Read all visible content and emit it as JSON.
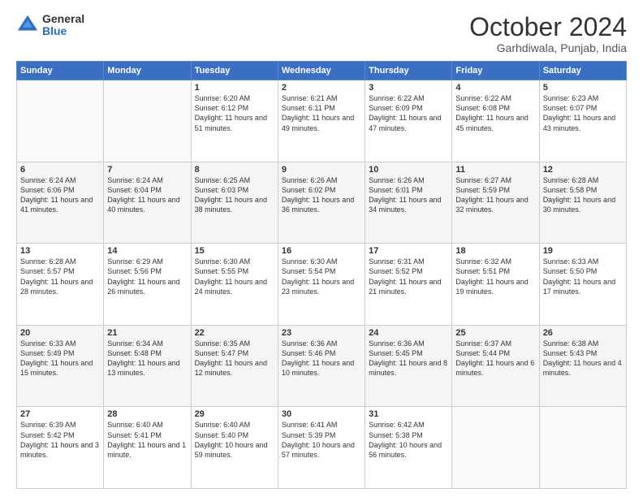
{
  "logo": {
    "general": "General",
    "blue": "Blue"
  },
  "title": "October 2024",
  "subtitle": "Garhdiwala, Punjab, India",
  "headers": [
    "Sunday",
    "Monday",
    "Tuesday",
    "Wednesday",
    "Thursday",
    "Friday",
    "Saturday"
  ],
  "weeks": [
    [
      {
        "day": "",
        "info": ""
      },
      {
        "day": "",
        "info": ""
      },
      {
        "day": "1",
        "info": "Sunrise: 6:20 AM\nSunset: 6:12 PM\nDaylight: 11 hours and 51 minutes."
      },
      {
        "day": "2",
        "info": "Sunrise: 6:21 AM\nSunset: 6:11 PM\nDaylight: 11 hours and 49 minutes."
      },
      {
        "day": "3",
        "info": "Sunrise: 6:22 AM\nSunset: 6:09 PM\nDaylight: 11 hours and 47 minutes."
      },
      {
        "day": "4",
        "info": "Sunrise: 6:22 AM\nSunset: 6:08 PM\nDaylight: 11 hours and 45 minutes."
      },
      {
        "day": "5",
        "info": "Sunrise: 6:23 AM\nSunset: 6:07 PM\nDaylight: 11 hours and 43 minutes."
      }
    ],
    [
      {
        "day": "6",
        "info": "Sunrise: 6:24 AM\nSunset: 6:06 PM\nDaylight: 11 hours and 41 minutes."
      },
      {
        "day": "7",
        "info": "Sunrise: 6:24 AM\nSunset: 6:04 PM\nDaylight: 11 hours and 40 minutes."
      },
      {
        "day": "8",
        "info": "Sunrise: 6:25 AM\nSunset: 6:03 PM\nDaylight: 11 hours and 38 minutes."
      },
      {
        "day": "9",
        "info": "Sunrise: 6:26 AM\nSunset: 6:02 PM\nDaylight: 11 hours and 36 minutes."
      },
      {
        "day": "10",
        "info": "Sunrise: 6:26 AM\nSunset: 6:01 PM\nDaylight: 11 hours and 34 minutes."
      },
      {
        "day": "11",
        "info": "Sunrise: 6:27 AM\nSunset: 5:59 PM\nDaylight: 11 hours and 32 minutes."
      },
      {
        "day": "12",
        "info": "Sunrise: 6:28 AM\nSunset: 5:58 PM\nDaylight: 11 hours and 30 minutes."
      }
    ],
    [
      {
        "day": "13",
        "info": "Sunrise: 6:28 AM\nSunset: 5:57 PM\nDaylight: 11 hours and 28 minutes."
      },
      {
        "day": "14",
        "info": "Sunrise: 6:29 AM\nSunset: 5:56 PM\nDaylight: 11 hours and 26 minutes."
      },
      {
        "day": "15",
        "info": "Sunrise: 6:30 AM\nSunset: 5:55 PM\nDaylight: 11 hours and 24 minutes."
      },
      {
        "day": "16",
        "info": "Sunrise: 6:30 AM\nSunset: 5:54 PM\nDaylight: 11 hours and 23 minutes."
      },
      {
        "day": "17",
        "info": "Sunrise: 6:31 AM\nSunset: 5:52 PM\nDaylight: 11 hours and 21 minutes."
      },
      {
        "day": "18",
        "info": "Sunrise: 6:32 AM\nSunset: 5:51 PM\nDaylight: 11 hours and 19 minutes."
      },
      {
        "day": "19",
        "info": "Sunrise: 6:33 AM\nSunset: 5:50 PM\nDaylight: 11 hours and 17 minutes."
      }
    ],
    [
      {
        "day": "20",
        "info": "Sunrise: 6:33 AM\nSunset: 5:49 PM\nDaylight: 11 hours and 15 minutes."
      },
      {
        "day": "21",
        "info": "Sunrise: 6:34 AM\nSunset: 5:48 PM\nDaylight: 11 hours and 13 minutes."
      },
      {
        "day": "22",
        "info": "Sunrise: 6:35 AM\nSunset: 5:47 PM\nDaylight: 11 hours and 12 minutes."
      },
      {
        "day": "23",
        "info": "Sunrise: 6:36 AM\nSunset: 5:46 PM\nDaylight: 11 hours and 10 minutes."
      },
      {
        "day": "24",
        "info": "Sunrise: 6:36 AM\nSunset: 5:45 PM\nDaylight: 11 hours and 8 minutes."
      },
      {
        "day": "25",
        "info": "Sunrise: 6:37 AM\nSunset: 5:44 PM\nDaylight: 11 hours and 6 minutes."
      },
      {
        "day": "26",
        "info": "Sunrise: 6:38 AM\nSunset: 5:43 PM\nDaylight: 11 hours and 4 minutes."
      }
    ],
    [
      {
        "day": "27",
        "info": "Sunrise: 6:39 AM\nSunset: 5:42 PM\nDaylight: 11 hours and 3 minutes."
      },
      {
        "day": "28",
        "info": "Sunrise: 6:40 AM\nSunset: 5:41 PM\nDaylight: 11 hours and 1 minute."
      },
      {
        "day": "29",
        "info": "Sunrise: 6:40 AM\nSunset: 5:40 PM\nDaylight: 10 hours and 59 minutes."
      },
      {
        "day": "30",
        "info": "Sunrise: 6:41 AM\nSunset: 5:39 PM\nDaylight: 10 hours and 57 minutes."
      },
      {
        "day": "31",
        "info": "Sunrise: 6:42 AM\nSunset: 5:38 PM\nDaylight: 10 hours and 56 minutes."
      },
      {
        "day": "",
        "info": ""
      },
      {
        "day": "",
        "info": ""
      }
    ]
  ]
}
